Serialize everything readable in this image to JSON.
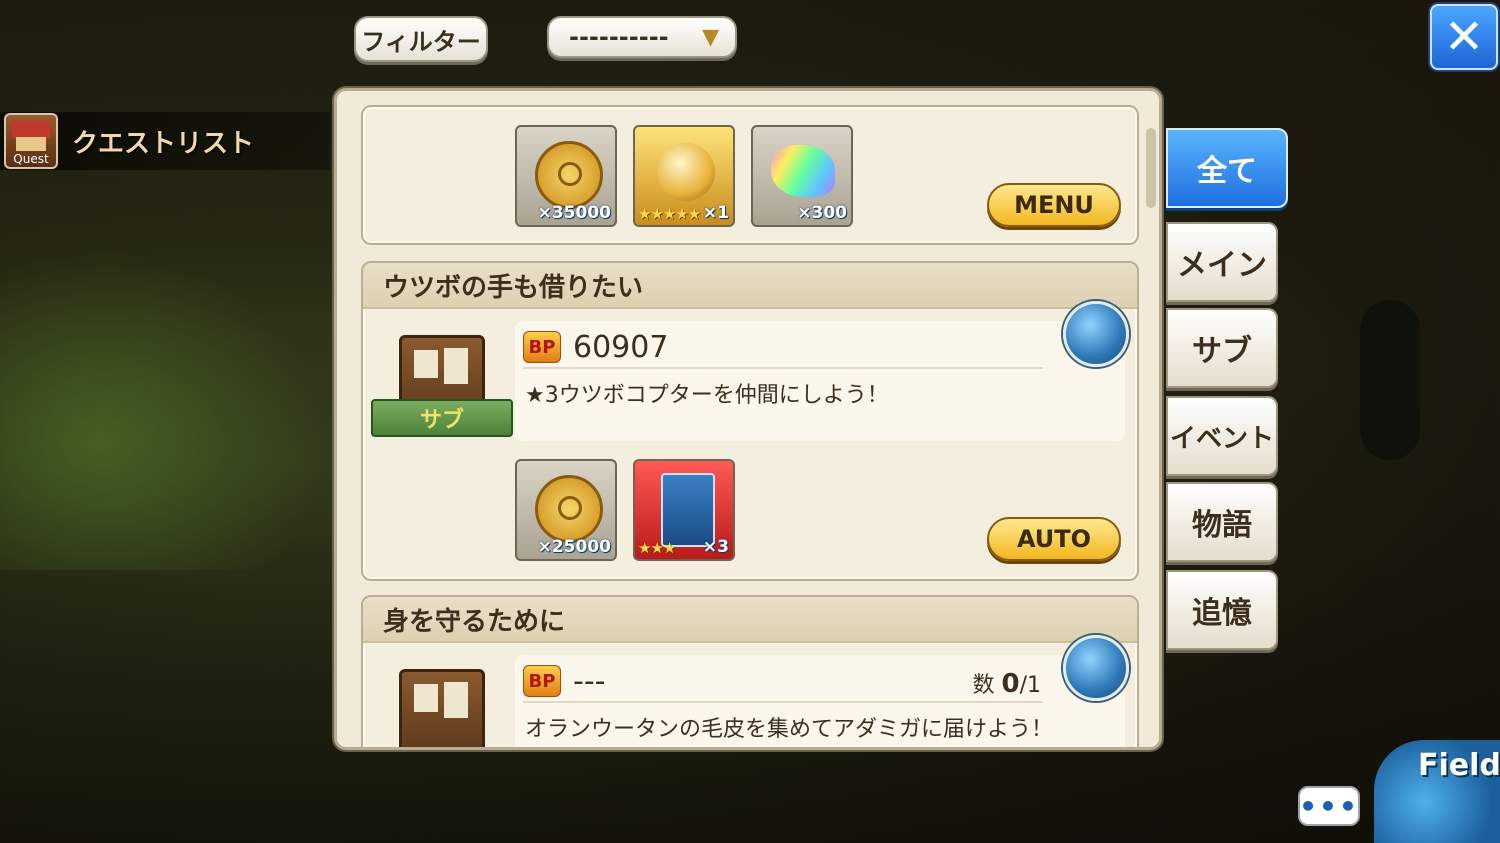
{
  "top": {
    "filter_label": "フィルター",
    "filter_select_value": "----------",
    "filter_arrow": "▼",
    "close_glyph": "✕"
  },
  "quest_header": {
    "icon_label": "Quest",
    "title": "クエストリスト"
  },
  "cards": [
    {
      "rewards": [
        {
          "type": "coin",
          "qty": "×35000"
        },
        {
          "type": "orb",
          "stars": "★★★★★",
          "qty": "×1"
        },
        {
          "type": "prism",
          "qty": "×300"
        }
      ],
      "action": "MENU"
    },
    {
      "title": "ウツボの手も借りたい",
      "category": "サブ",
      "bp_label": "BP",
      "bp": "60907",
      "description": "★3ウツボコプターを仲間にしよう！",
      "rewards": [
        {
          "type": "coin",
          "qty": "×25000"
        },
        {
          "type": "book",
          "stars": "★★★",
          "qty": "×3"
        }
      ],
      "action": "AUTO"
    },
    {
      "title": "身を守るために",
      "bp_label": "BP",
      "bp": "---",
      "count_label": "数",
      "count_value": "0",
      "count_total": "/1",
      "description": "オランウータンの毛皮を集めてアダミガに届けよう！"
    }
  ],
  "tabs": [
    "全て",
    "メイン",
    "サブ",
    "イベント",
    "物語",
    "追憶"
  ],
  "active_tab": "全て",
  "chat_glyph": "•••",
  "field_label": "Field"
}
